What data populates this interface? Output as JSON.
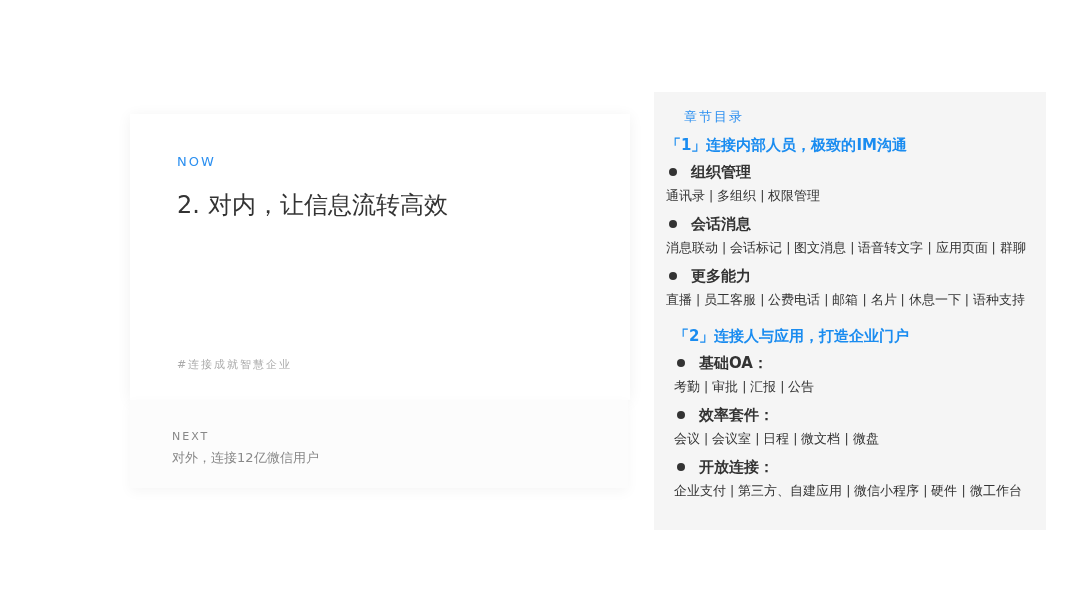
{
  "current": {
    "label": "NOW",
    "title": "2. 对内，让信息流转高效",
    "tag": "#连接成就智慧企业"
  },
  "next": {
    "label": "NEXT",
    "title": "对外，连接12亿微信用户"
  },
  "toc": {
    "heading": "章节目录",
    "sections": [
      {
        "title": "「1」连接内部人员，极致的IM沟通",
        "groups": [
          {
            "name": "组织管理",
            "items": "通讯录 | 多组织 | 权限管理"
          },
          {
            "name": "会话消息",
            "items": "消息联动 | 会话标记 | 图文消息 | 语音转文字 | 应用页面 | 群聊"
          },
          {
            "name": "更多能力",
            "items": "直播 | 员工客服 | 公费电话 | 邮箱 | 名片 | 休息一下 | 语种支持"
          }
        ]
      },
      {
        "title": "「2」连接人与应用，打造企业门户",
        "groups": [
          {
            "name": "基础OA：",
            "items": "考勤 | 审批 | 汇报 | 公告"
          },
          {
            "name": "效率套件：",
            "items": "会议 | 会议室 | 日程 | 微文档 | 微盘"
          },
          {
            "name": "开放连接：",
            "items": "企业支付 | 第三方、自建应用 | 微信小程序 | 硬件 | 微工作台"
          }
        ]
      }
    ]
  }
}
